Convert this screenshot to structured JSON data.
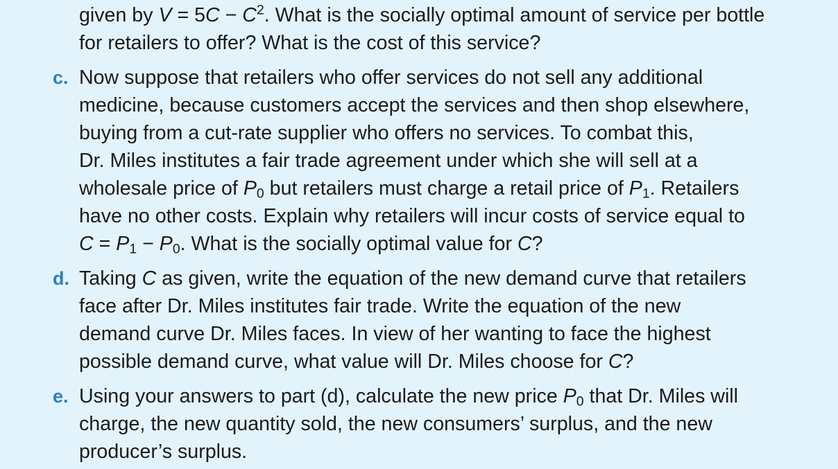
{
  "part_b_tail": {
    "line1": {
      "pre": "given by ",
      "V": "V",
      "eq": " = 5",
      "C1": "C",
      "minus": " − ",
      "C2": "C",
      "sq": "2",
      "post": ". What is the socially optimal amount of service per bottle"
    },
    "line2": "for retailers to offer? What is the cost of this service?"
  },
  "part_c": {
    "letter": "c.",
    "line1": "Now suppose that retailers who offer services do not sell any additional",
    "line2": "medicine, because customers accept the services and then shop elsewhere,",
    "line3": "buying from a cut-rate supplier who offers no services. To combat this,",
    "line4": "Dr. Miles institutes a fair trade agreement under which she will sell at a",
    "line5": {
      "pre": "wholesale price of ",
      "P": "P",
      "sub0": "0",
      "mid": " but retailers must charge a retail price of ",
      "P1": "P",
      "sub1": "1",
      "post": ". Retailers"
    },
    "line6": "have no other costs. Explain why retailers will incur costs of service equal to",
    "line7": {
      "C": "C",
      "eq": " = ",
      "P1": "P",
      "sub1": "1",
      "minus": " − ",
      "P0": "P",
      "sub0": "0",
      "mid": ". What is the socially optimal value for ",
      "C2": "C",
      "post": "?"
    }
  },
  "part_d": {
    "letter": "d.",
    "line1": {
      "pre": "Taking ",
      "C": "C",
      "post": " as given, write the equation of the new demand curve that retailers"
    },
    "line2": "face after Dr. Miles institutes fair trade. Write the equation of the new",
    "line3": "demand curve Dr. Miles faces. In view of her wanting to face the highest",
    "line4": {
      "pre": "possible demand curve, what value will Dr. Miles choose for ",
      "C": "C",
      "post": "?"
    }
  },
  "part_e": {
    "letter": "e.",
    "line1": {
      "pre": "Using your answers to part (d), calculate the new price ",
      "P": "P",
      "sub0": "0",
      "post": " that Dr. Miles will"
    },
    "line2": "charge, the new quantity sold, the new consumers’ surplus, and the new",
    "line3": "producer’s surplus."
  }
}
